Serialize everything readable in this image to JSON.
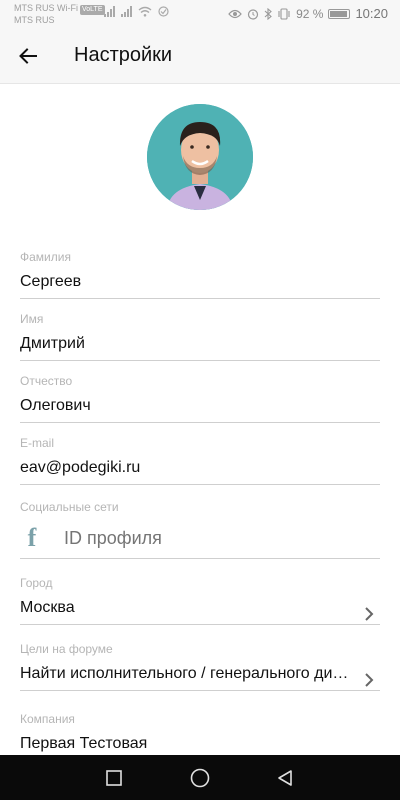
{
  "status_bar": {
    "carrier_1": "MTS RUS Wi-Fi",
    "volte": "VoLTE",
    "carrier_2": "MTS RUS",
    "battery_percent": "92 %",
    "time": "10:20"
  },
  "appbar": {
    "title": "Настройки"
  },
  "fields": {
    "last_name": {
      "label": "Фамилия",
      "value": "Сергеев"
    },
    "first_name": {
      "label": "Имя",
      "value": "Дмитрий"
    },
    "patronymic": {
      "label": "Отчество",
      "value": "Олегович"
    },
    "email": {
      "label": "E-mail",
      "value": "eav@podegiki.ru"
    },
    "social": {
      "label": "Социальные сети",
      "placeholder": "ID профиля"
    },
    "city": {
      "label": "Город",
      "value": "Москва"
    },
    "goals": {
      "label": "Цели на форуме",
      "value": "Найти исполнительного / генерального директора"
    },
    "company": {
      "label": "Компания",
      "value": "Первая Тестовая"
    }
  },
  "colors": {
    "appbar_bg": "#f7f7f7",
    "avatar_bg": "#4fb2b4",
    "facebook_icon": "#7ba1a9",
    "nav_bar_bg": "#0a0a0a"
  }
}
